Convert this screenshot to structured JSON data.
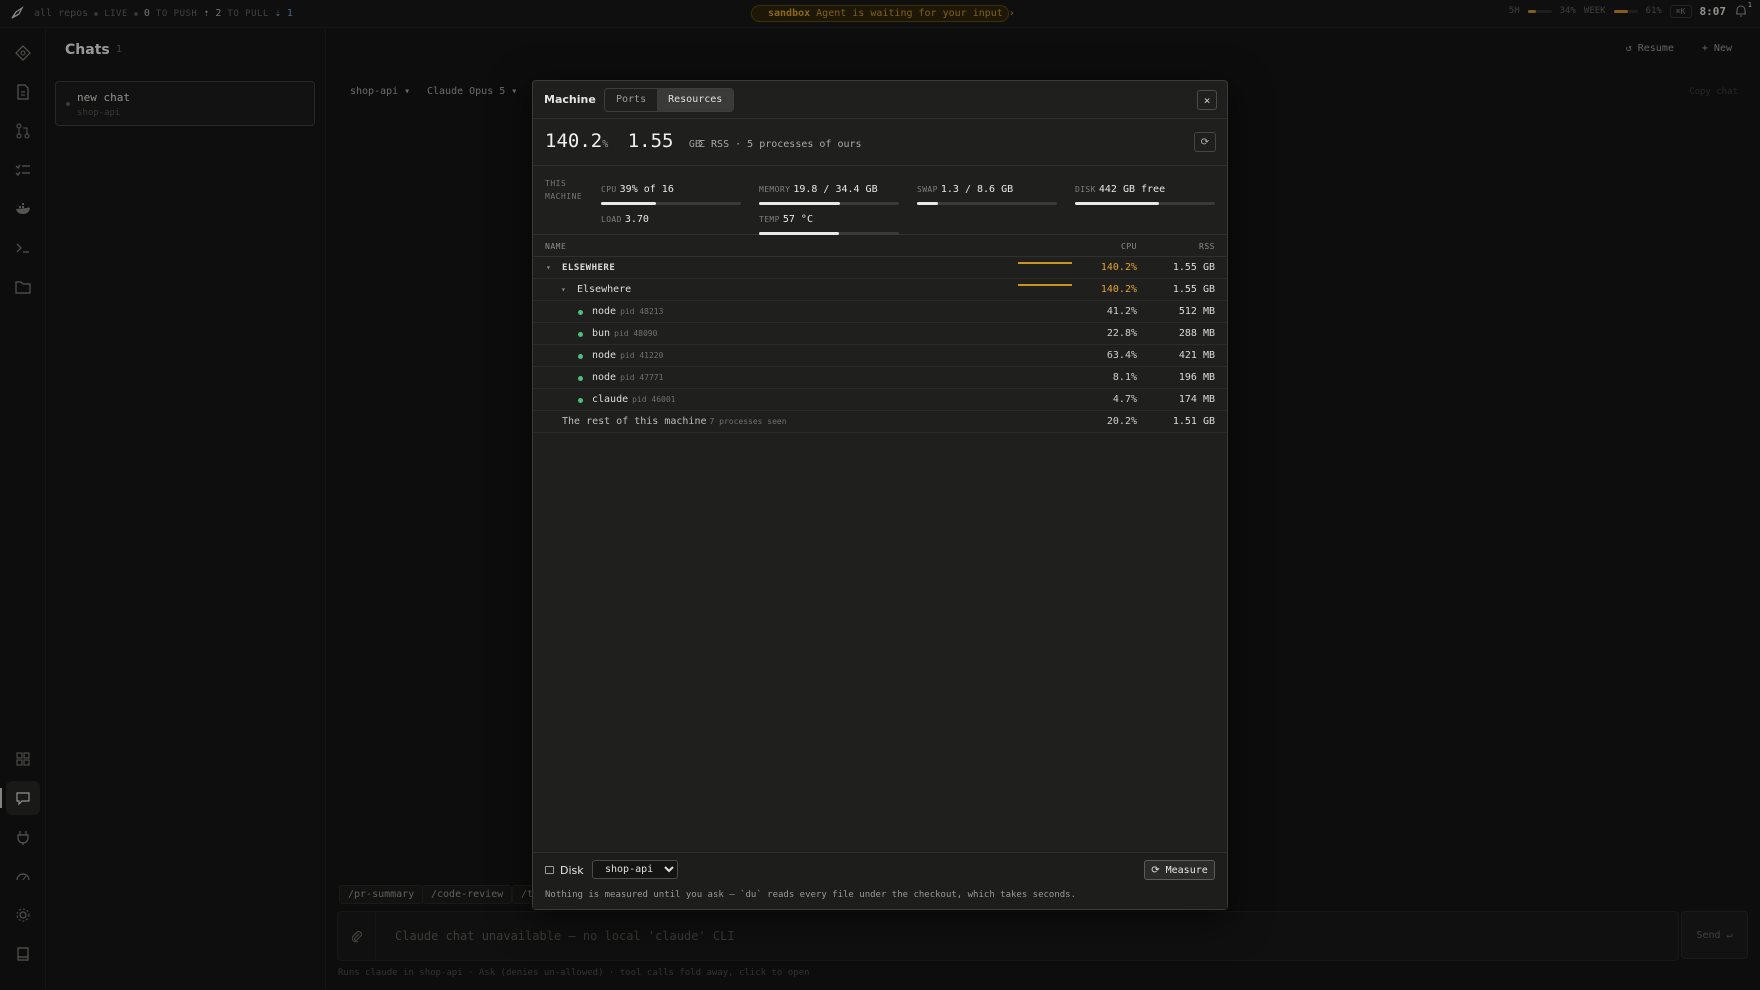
{
  "topbar": {
    "repos": "all repos",
    "live_label": "LIVE",
    "live_value": "0",
    "to_push_label": "TO PUSH",
    "to_push_value": "⇡ 2",
    "to_pull_label": "TO PULL",
    "to_pull_value": "⇣ 1",
    "sandbox_name": "sandbox",
    "sandbox_msg": "Agent is waiting for your input",
    "sandbox_chevron": "›",
    "usage_5h_label": "5H",
    "usage_5h_value": "34%",
    "usage_5h_fraction": 0.34,
    "usage_week_label": "WEEK",
    "usage_week_value": "61%",
    "usage_week_fraction": 0.61,
    "kbd": "⌘K",
    "clock": "8:07",
    "notif_count": "1",
    "accent_color": "#c9961f"
  },
  "rail_icons": [
    "graph-icon",
    "document-icon",
    "git-pull-request-icon",
    "checklist-icon",
    "docker-icon",
    "terminal-icon",
    "folder-icon",
    "grid-icon",
    "chat-icon",
    "plug-icon",
    "gauge-icon",
    "settings-icon",
    "book-icon"
  ],
  "chats": {
    "title": "Chats",
    "count": "1",
    "items": [
      {
        "name": "new chat",
        "repo": "shop-api"
      }
    ]
  },
  "main": {
    "resume_label": "↺ Resume",
    "new_label": "+ New",
    "repo_chip": "shop-api ▾",
    "model_chip": "Claude Opus 5 ▾",
    "copy_chat": "Copy chat",
    "slash_commands": [
      "/pr-summary",
      "/code-review",
      "/t"
    ],
    "composer_placeholder": "Claude chat unavailable — no local 'claude' CLI",
    "send_label": "Send ↵",
    "footnote": "Runs claude in shop-api · Ask (denies un-allowed) · tool calls fold away, click to open"
  },
  "modal": {
    "title": "Machine",
    "tabs": [
      {
        "label": "Ports",
        "active": false
      },
      {
        "label": "Resources",
        "active": true
      }
    ],
    "close": "×",
    "summary": {
      "cpu_value": "140.2",
      "cpu_unit": "%",
      "rss_value": "1.55",
      "rss_unit": "GB",
      "desc": "Σ RSS · 5 processes of ours",
      "refresh": "⟳"
    },
    "stats": {
      "this_machine_line1": "THIS",
      "this_machine_line2": "MACHINE",
      "cpu_label": "CPU",
      "cpu_value": "39% of 16",
      "cpu_fraction": 0.39,
      "memory_label": "MEMORY",
      "memory_value": "19.8 / 34.4 GB",
      "memory_fraction": 0.575,
      "swap_label": "SWAP",
      "swap_value": "1.3 / 8.6 GB",
      "swap_fraction": 0.15,
      "disk_label": "DISK",
      "disk_value": "442 GB free",
      "disk_fraction": 0.6,
      "load_label": "LOAD",
      "load_value": "3.70",
      "temp_label": "TEMP",
      "temp_value": "57 °C",
      "temp_fraction": 0.57
    },
    "table": {
      "col_name": "NAME",
      "col_cpu": "CPU",
      "col_rss": "RSS",
      "group": {
        "name": "ELSEWHERE",
        "cpu": "140.2%",
        "rss": "1.55 GB"
      },
      "subgroup": {
        "name": "Elsewhere",
        "cpu": "140.2%",
        "rss": "1.55 GB"
      },
      "processes": [
        {
          "name": "node",
          "pid": "pid 48213",
          "cpu": "41.2%",
          "rss": "512 MB"
        },
        {
          "name": "bun",
          "pid": "pid 48090",
          "cpu": "22.8%",
          "rss": "288 MB"
        },
        {
          "name": "node",
          "pid": "pid 41220",
          "cpu": "63.4%",
          "rss": "421 MB"
        },
        {
          "name": "node",
          "pid": "pid 47771",
          "cpu": "8.1%",
          "rss": "196 MB"
        },
        {
          "name": "claude",
          "pid": "pid 46001",
          "cpu": "4.7%",
          "rss": "174 MB"
        }
      ],
      "rest": {
        "name": "The rest of this machine",
        "seen": "7 processes seen",
        "cpu": "20.2%",
        "rss": "1.51 GB"
      }
    },
    "footer": {
      "disk_label": "Disk",
      "disk_select": "shop-api",
      "measure_label": "⟳ Measure",
      "note": "Nothing is measured until you ask — `du` reads every file under the checkout, which takes seconds."
    }
  }
}
